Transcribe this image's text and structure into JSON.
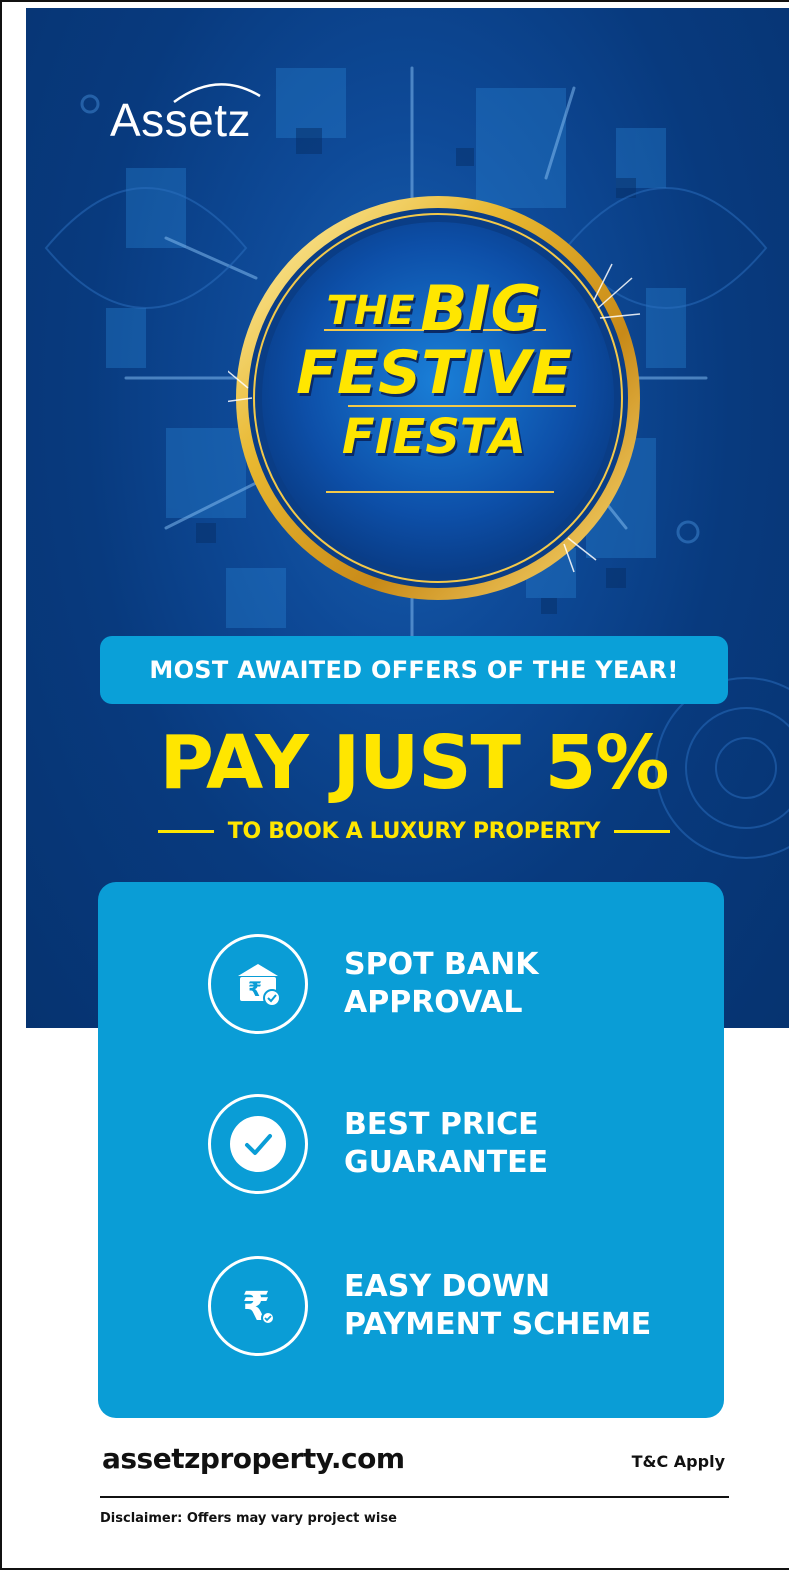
{
  "brand": {
    "logo_text": "Assetz"
  },
  "hero": {
    "line1_small": "THE",
    "line1_large": "BIG",
    "line2": "FESTIVE",
    "line3": "FIESTA"
  },
  "offer": {
    "banner": "MOST AWAITED OFFERS OF THE YEAR!",
    "headline": "PAY JUST 5%",
    "subheadline": "TO BOOK A LUXURY PROPERTY"
  },
  "benefits": [
    {
      "icon": "bank-rupee-icon",
      "line1": "SPOT BANK",
      "line2": "APPROVAL"
    },
    {
      "icon": "checkmark-icon",
      "line1": "BEST PRICE",
      "line2": "GUARANTEE"
    },
    {
      "icon": "rupee-icon",
      "line1": "EASY DOWN",
      "line2": "PAYMENT SCHEME"
    }
  ],
  "footer": {
    "website": "assetzproperty.com",
    "terms": "T&C Apply",
    "disclaimer": "Disclaimer: Offers may vary project wise"
  },
  "colors": {
    "navy": "#083a7e",
    "sky_blue": "#0aa0d8",
    "yellow": "#ffe600",
    "gold": "#e8b730",
    "white": "#ffffff"
  }
}
